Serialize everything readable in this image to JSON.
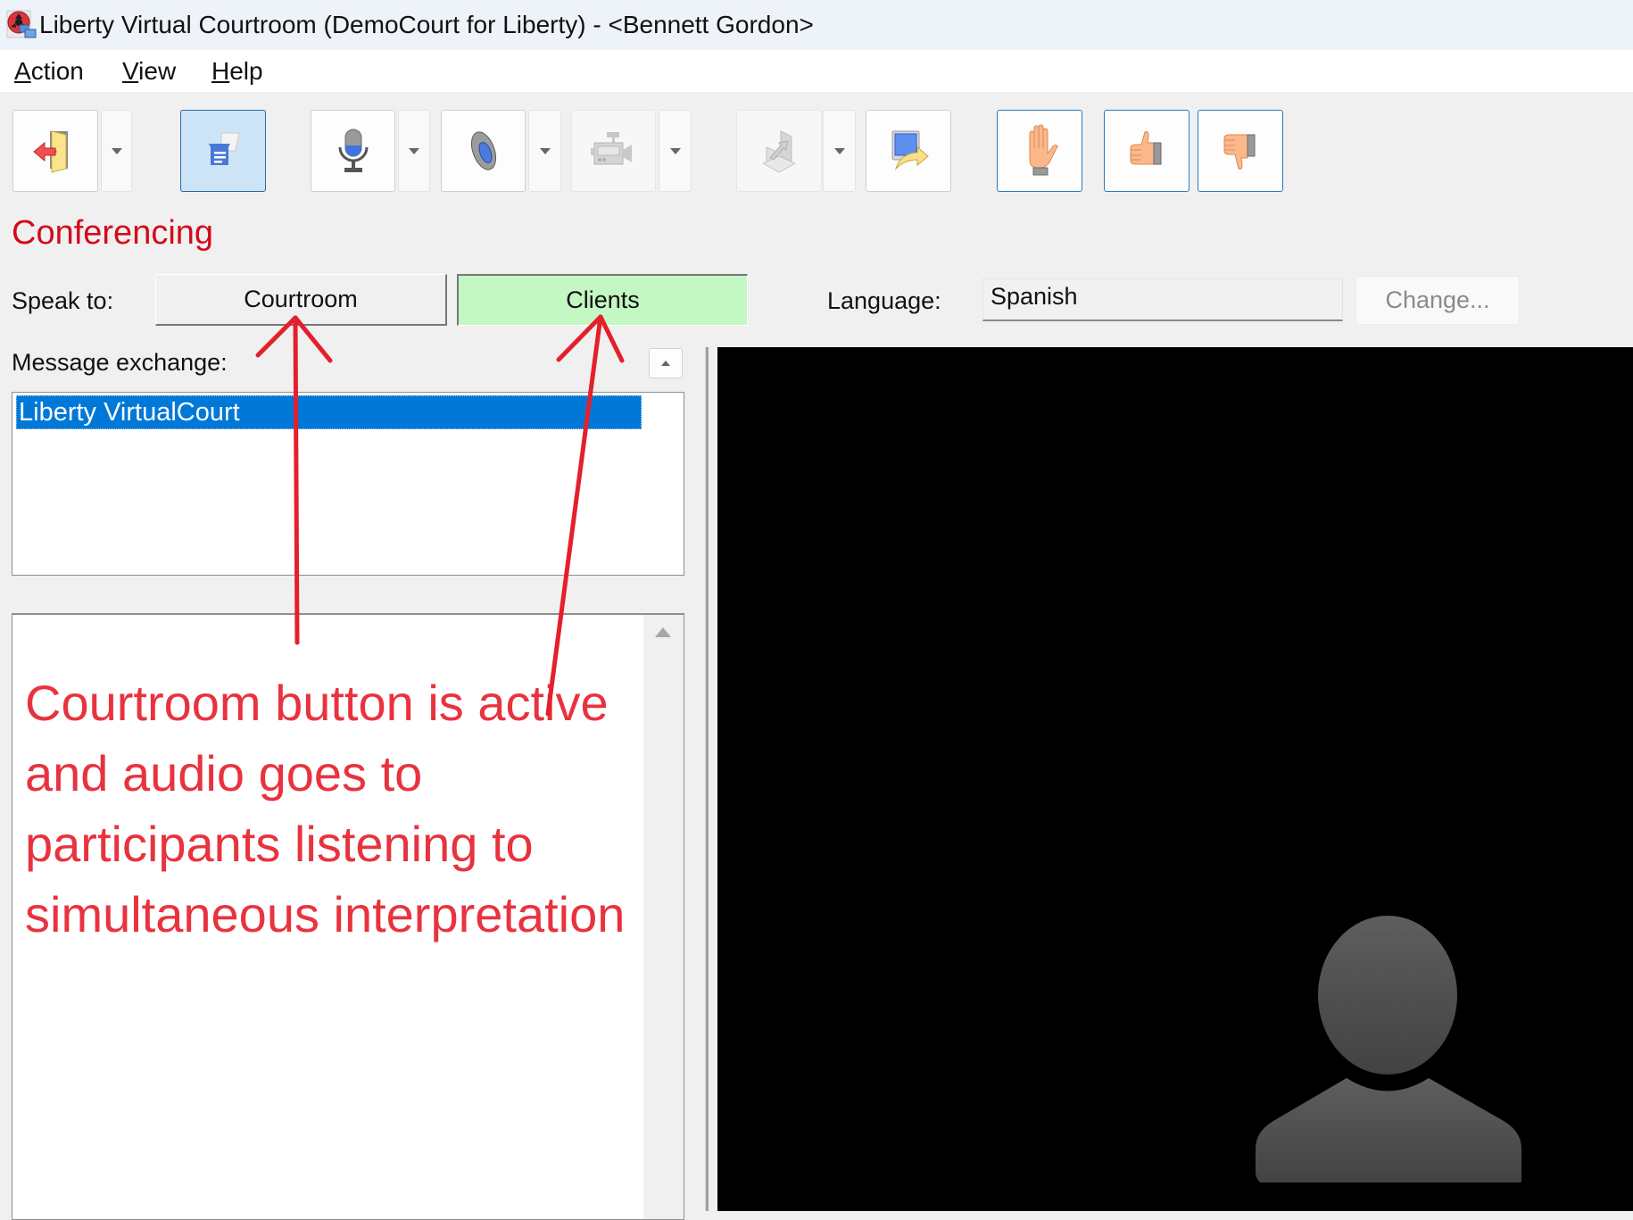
{
  "window": {
    "title": "Liberty Virtual Courtroom (DemoCourt for Liberty) - <Bennett Gordon>",
    "app_icon": "liberty-app-icon"
  },
  "menu": {
    "items": [
      {
        "label_accel": "A",
        "label_rest": "ction",
        "label": "Action"
      },
      {
        "label_accel": "V",
        "label_rest": "iew",
        "label": "View"
      },
      {
        "label_accel": "H",
        "label_rest": "elp",
        "label": "Help"
      }
    ]
  },
  "toolbar": {
    "buttons": [
      {
        "name": "leave-courtroom",
        "icon": "exit-door-icon",
        "has_dropdown": true,
        "state": "normal"
      },
      {
        "name": "messages",
        "icon": "chat-messages-icon",
        "has_dropdown": false,
        "state": "checked"
      },
      {
        "name": "microphone",
        "icon": "microphone-icon",
        "has_dropdown": true,
        "state": "normal"
      },
      {
        "name": "speaker",
        "icon": "speaker-icon",
        "has_dropdown": true,
        "state": "normal"
      },
      {
        "name": "camera",
        "icon": "video-camera-icon",
        "has_dropdown": true,
        "state": "disabled"
      },
      {
        "name": "share",
        "icon": "share-document-icon",
        "has_dropdown": true,
        "state": "disabled"
      },
      {
        "name": "present-screen",
        "icon": "present-screen-icon",
        "has_dropdown": false,
        "state": "normal"
      },
      {
        "name": "raise-hand",
        "icon": "raise-hand-icon",
        "has_dropdown": false,
        "state": "outlined"
      },
      {
        "name": "thumbs-up",
        "icon": "thumbs-up-icon",
        "has_dropdown": false,
        "state": "outlined"
      },
      {
        "name": "thumbs-down",
        "icon": "thumbs-down-icon",
        "has_dropdown": false,
        "state": "outlined"
      }
    ]
  },
  "conferencing": {
    "heading": "Conferencing",
    "speak_to_label": "Speak to:",
    "speak_to_options": [
      {
        "label": "Courtroom",
        "active": false
      },
      {
        "label": "Clients",
        "active": true
      }
    ],
    "language_label": "Language:",
    "language_value": "Spanish",
    "change_button": "Change...",
    "active_color": "#c3f7c3",
    "heading_color": "#d40a1a"
  },
  "messages": {
    "label": "Message exchange:",
    "recipients": [
      {
        "label": "Liberty VirtualCourt",
        "selected": true
      }
    ],
    "selection_color": "#0078d7"
  },
  "annotation": {
    "text": "Courtroom button is active and audio goes to participants listening to simultaneous interpretation",
    "color": "#e8333f",
    "arrows_point_to": [
      "Courtroom",
      "Clients"
    ]
  },
  "video": {
    "placeholder": "participant-avatar-silhouette",
    "background": "#000000"
  }
}
